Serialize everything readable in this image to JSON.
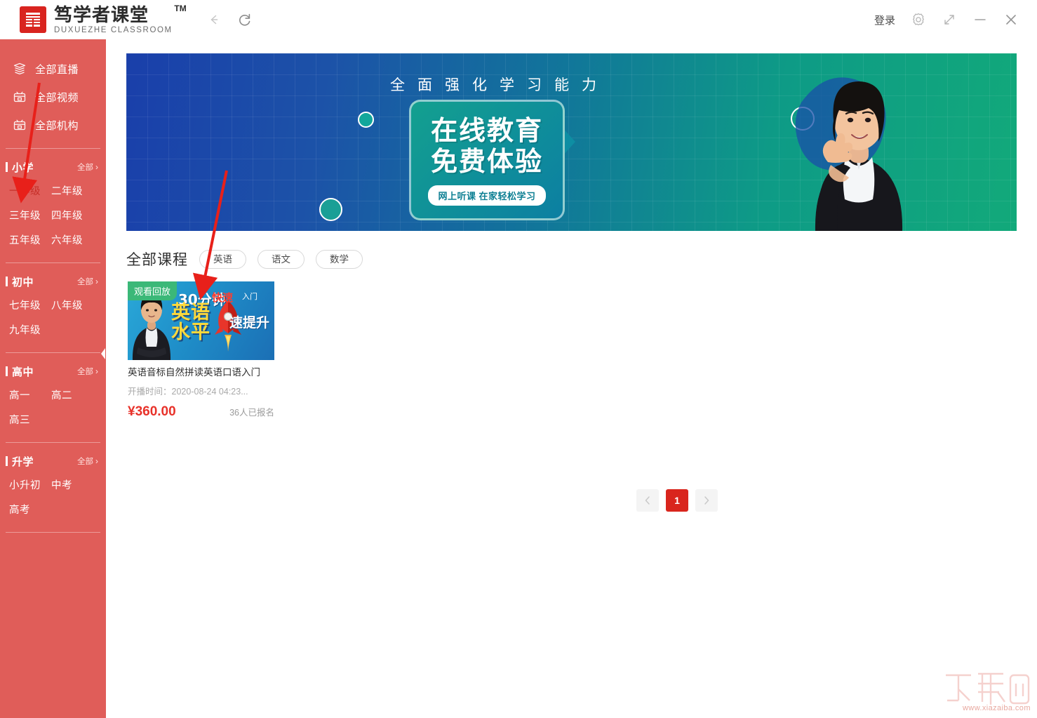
{
  "window": {
    "brand_cn": "笃学者课堂",
    "brand_tm": "TM",
    "brand_en": "DUXUEZHE CLASSROOM",
    "logo_glyph": "篤",
    "back_icon": "back-arrow-icon",
    "refresh_icon": "refresh-icon",
    "login_label": "登录",
    "settings_icon": "gear-icon",
    "maximize_icon": "expand-icon",
    "minimize_icon": "minimize-icon",
    "close_icon": "close-icon"
  },
  "sidebar": {
    "bg_color": "#e05d59",
    "links": [
      {
        "label": "全部直播",
        "icon": "live-stack-icon"
      },
      {
        "label": "全部视频",
        "icon": "video-box-icon"
      },
      {
        "label": "全部机构",
        "icon": "institution-box-icon"
      }
    ],
    "all_label": "全部",
    "chevron": "›",
    "sections": [
      {
        "title": "小学",
        "all_label": "全部",
        "grades": [
          {
            "label": "一年级",
            "active": true
          },
          {
            "label": "二年级",
            "active": false
          },
          {
            "label": "三年级",
            "active": false
          },
          {
            "label": "四年级",
            "active": false
          },
          {
            "label": "五年级",
            "active": false
          },
          {
            "label": "六年级",
            "active": false
          }
        ]
      },
      {
        "title": "初中",
        "all_label": "全部",
        "grades": [
          {
            "label": "七年级",
            "active": false
          },
          {
            "label": "八年级",
            "active": false
          },
          {
            "label": "九年级",
            "active": false
          }
        ]
      },
      {
        "title": "高中",
        "all_label": "全部",
        "grades": [
          {
            "label": "高一",
            "active": false
          },
          {
            "label": "高二",
            "active": false
          },
          {
            "label": "高三",
            "active": false
          }
        ]
      },
      {
        "title": "升学",
        "all_label": "全部",
        "grades": [
          {
            "label": "小升初",
            "active": false
          },
          {
            "label": "中考",
            "active": false
          },
          {
            "label": "高考",
            "active": false
          }
        ]
      }
    ],
    "collapse_icon": "collapse-left-triangle-icon"
  },
  "banner": {
    "headline": "全面强化学习能力",
    "card_line1": "在线教育",
    "card_line2": "免费体验",
    "card_pill": "网上听课 在家轻松学习",
    "gradient_from": "#1a3faa",
    "gradient_to": "#12a97a"
  },
  "courses": {
    "heading": "全部课程",
    "filters": [
      {
        "label": "英语"
      },
      {
        "label": "语文"
      },
      {
        "label": "数学"
      }
    ],
    "items": [
      {
        "badge": "观看回放",
        "title": "英语音标自然拼读英语口语入门",
        "time_label": "开播时间：",
        "time_value": "2020-08-24 04:23...",
        "price": "¥360.00",
        "enrolled": "36人已报名",
        "thumb": {
          "t_minutes": "30分钟",
          "t_fast": "快速",
          "t_entry": "入门",
          "t_big_line1": "英语",
          "t_big_line2": "水平",
          "t_right": "速提升"
        }
      }
    ]
  },
  "pagination": {
    "prev_icon": "chevron-left-icon",
    "next_icon": "chevron-right-icon",
    "pages": [
      {
        "label": "1",
        "active": true
      }
    ]
  },
  "watermark": {
    "logo_text": "下载吧",
    "url": "www.xiazaiba.com"
  }
}
